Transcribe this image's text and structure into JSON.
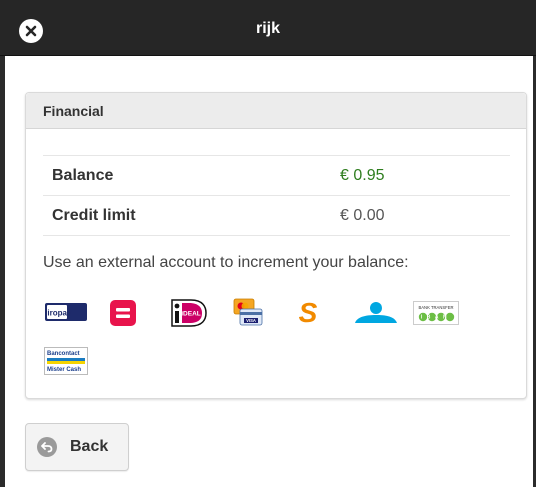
{
  "header": {
    "title": "rijk"
  },
  "panel": {
    "title": "Financial",
    "rows": [
      {
        "label": "Balance",
        "value": "€ 0.95",
        "color": "#2e7d1e"
      },
      {
        "label": "Credit limit",
        "value": "€ 0.00",
        "color": "#555555"
      }
    ],
    "hint": "Use an external account to increment your balance:",
    "payment_methods": [
      {
        "name": "Giropay",
        "logo_text": "giropay",
        "icon": "giropay-icon"
      },
      {
        "name": "Bancomat/=",
        "icon": "equals-payment-icon"
      },
      {
        "name": "iDEAL",
        "logo_text": "iDEAL",
        "icon": "ideal-icon"
      },
      {
        "name": "Credit card",
        "logo_text": "VISA",
        "icon": "credit-card-icon"
      },
      {
        "name": "Sofort",
        "logo_text": "S",
        "icon": "sofort-icon"
      },
      {
        "name": "Transfer person",
        "icon": "transfer-icon"
      },
      {
        "name": "Bank transfer IBAN",
        "logo_text": "BANK TRANSFER",
        "logo_sub": "IBAN",
        "icon": "iban-icon"
      },
      {
        "name": "Bancontact Mister Cash",
        "logo_text": "Bancontact",
        "logo_sub": "Mister Cash",
        "icon": "bancontact-icon"
      }
    ]
  },
  "actions": {
    "back_label": "Back"
  }
}
